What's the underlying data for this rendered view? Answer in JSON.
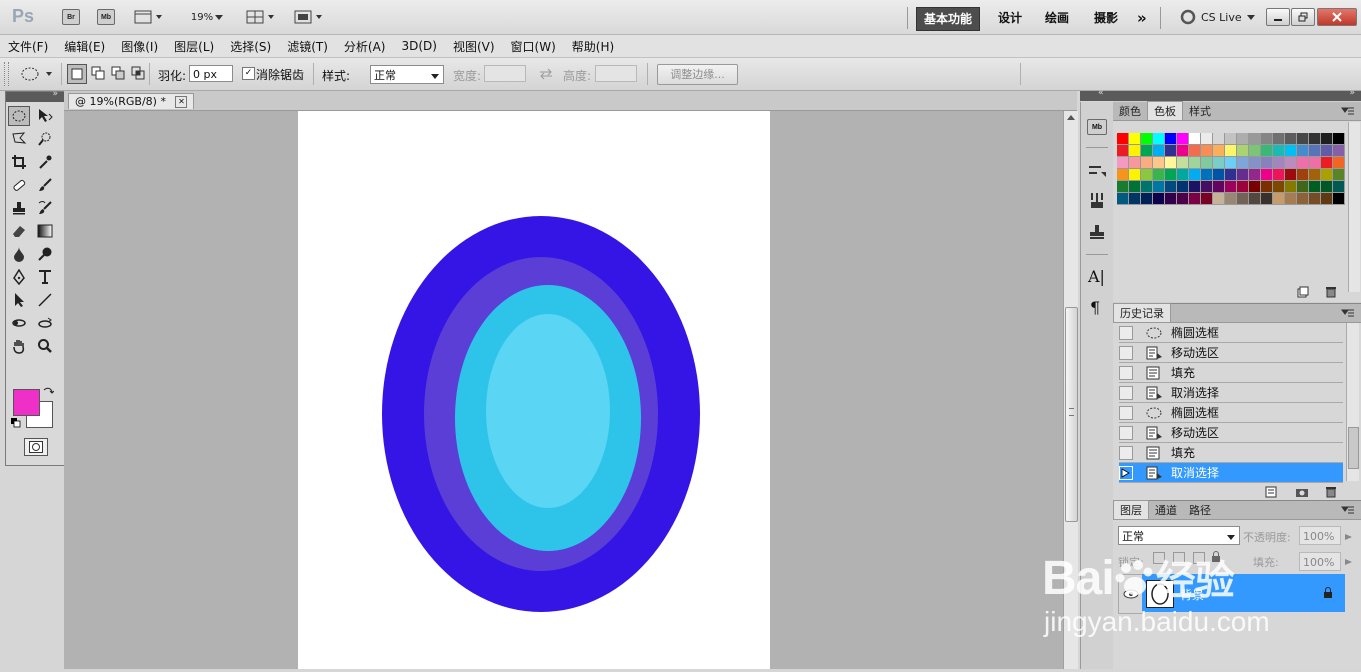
{
  "app": {
    "logo": "Ps",
    "zoom": "19%"
  },
  "appbar": {
    "bridge_label": "Br",
    "minibridge_label": "Mb",
    "workspaces": [
      {
        "label": "基本功能",
        "active": true
      },
      {
        "label": "设计",
        "active": false
      },
      {
        "label": "绘画",
        "active": false
      },
      {
        "label": "摄影",
        "active": false
      }
    ],
    "more": "»",
    "cslive": "CS Live"
  },
  "menu": [
    "文件(F)",
    "编辑(E)",
    "图像(I)",
    "图层(L)",
    "选择(S)",
    "滤镜(T)",
    "分析(A)",
    "3D(D)",
    "视图(V)",
    "窗口(W)",
    "帮助(H)"
  ],
  "options": {
    "feather_label": "羽化:",
    "feather_value": "0 px",
    "antialias_label": "消除锯齿",
    "antialias_checked": true,
    "style_label": "样式:",
    "style_value": "正常",
    "width_label": "宽度:",
    "height_label": "高度:",
    "refine_label": "调整边缘..."
  },
  "document": {
    "tab_title": "@ 19%(RGB/8) *"
  },
  "colors": {
    "foreground": "#ee2fc8",
    "background": "#ffffff",
    "ring1": "#3415e6",
    "ring2": "#5b3ed6",
    "ring3": "#2ec4ea",
    "ring4": "#5ad5f3"
  },
  "swatches_panel": {
    "tabs": [
      {
        "label": "颜色",
        "active": false
      },
      {
        "label": "色板",
        "active": true
      },
      {
        "label": "样式",
        "active": false
      }
    ]
  },
  "history_panel": {
    "title": "历史记录",
    "items": [
      {
        "label": "椭圆选框",
        "icon": "ellipse-marquee-icon"
      },
      {
        "label": "移动选区",
        "icon": "move-selection-icon"
      },
      {
        "label": "填充",
        "icon": "fill-icon"
      },
      {
        "label": "取消选择",
        "icon": "deselect-icon"
      },
      {
        "label": "椭圆选框",
        "icon": "ellipse-marquee-icon"
      },
      {
        "label": "移动选区",
        "icon": "move-selection-icon"
      },
      {
        "label": "填充",
        "icon": "fill-icon"
      },
      {
        "label": "取消选择",
        "icon": "deselect-icon",
        "active": true
      }
    ]
  },
  "layers_panel": {
    "tabs": [
      {
        "label": "图层",
        "active": true
      },
      {
        "label": "通道",
        "active": false
      },
      {
        "label": "路径",
        "active": false
      }
    ],
    "blend_mode": "正常",
    "opacity_label": "不透明度:",
    "opacity_value": "100%",
    "lock_label": "锁定:",
    "fill_label": "填充:",
    "fill_value": "100%",
    "layer_name": "背景"
  },
  "watermark": {
    "brand": "Bai",
    "brand_accent": "经验",
    "url": "jingyan.baidu.com"
  }
}
